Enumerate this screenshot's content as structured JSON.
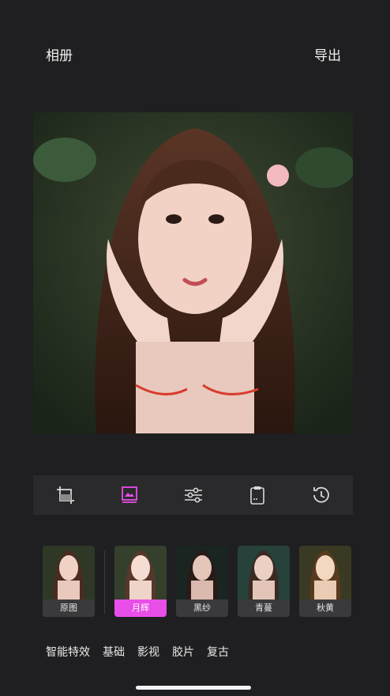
{
  "header": {
    "album_label": "相册",
    "export_label": "导出"
  },
  "toolbar": {
    "tools": [
      {
        "name": "crop-icon",
        "active": false
      },
      {
        "name": "image-filter-icon",
        "active": true
      },
      {
        "name": "adjust-sliders-icon",
        "active": false
      },
      {
        "name": "clipboard-icon",
        "active": false
      },
      {
        "name": "history-restore-icon",
        "active": false
      }
    ],
    "active_color": "#e84ee8"
  },
  "filters": {
    "items": [
      {
        "label": "原图",
        "active": false
      },
      {
        "label": "月辉",
        "active": true
      },
      {
        "label": "黑纱",
        "active": false
      },
      {
        "label": "青蔓",
        "active": false
      },
      {
        "label": "秋黄",
        "active": false
      }
    ]
  },
  "categories": [
    "智能特效",
    "基础",
    "影视",
    "胶片",
    "复古"
  ]
}
